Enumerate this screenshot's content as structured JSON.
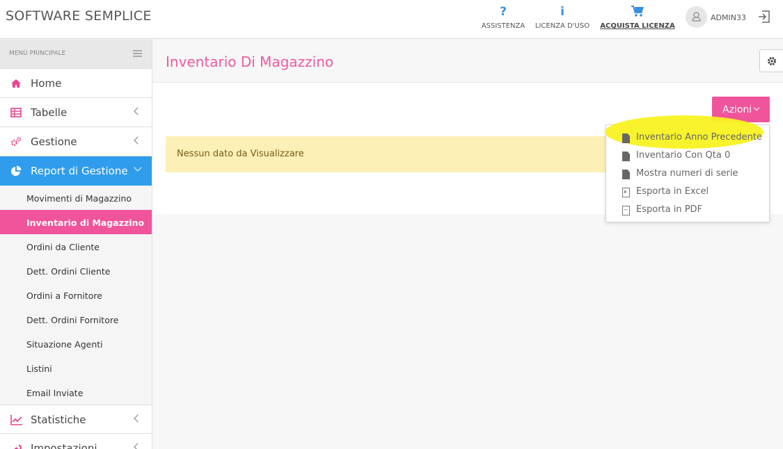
{
  "brand": "SOFTWARE SEMPLICE",
  "topnav": [
    {
      "icon": "question-icon",
      "glyph": "?",
      "label": "ASSISTENZA"
    },
    {
      "icon": "info-icon",
      "glyph": "i",
      "label": "LICENZA D'USO"
    },
    {
      "icon": "cart-icon",
      "glyph": "🛒",
      "label": "ACQUISTA LICENZA"
    }
  ],
  "user": {
    "name": "ADMIN33"
  },
  "sidebar": {
    "header": "MENÙ PRINCIPALE",
    "items": [
      {
        "label": "Home"
      },
      {
        "label": "Tabelle"
      },
      {
        "label": "Gestione"
      },
      {
        "label": "Report di Gestione"
      }
    ],
    "sub": [
      {
        "label": "Movimenti di Magazzino"
      },
      {
        "label": "Inventario di Magazzino"
      },
      {
        "label": "Ordini da Cliente"
      },
      {
        "label": "Dett. Ordini Cliente"
      },
      {
        "label": "Ordini a Fornitore"
      },
      {
        "label": "Dett. Ordini Fornitore"
      },
      {
        "label": "Situazione Agenti"
      },
      {
        "label": "Listini"
      },
      {
        "label": "Email Inviate"
      }
    ],
    "after": [
      {
        "label": "Statistiche"
      },
      {
        "label": "Impostazioni"
      }
    ]
  },
  "page": {
    "title": "Inventario Di Magazzino",
    "actions_label": "Azioni",
    "alert": "Nessun dato da Visualizzare"
  },
  "dropdown": [
    {
      "label": "Inventario Anno Precedente",
      "icon": "file-icon"
    },
    {
      "label": "Inventario Con Qta 0",
      "icon": "file-icon"
    },
    {
      "label": "Mostra numeri di serie",
      "icon": "file-icon"
    },
    {
      "label": "Esporta in Excel",
      "icon": "excel-file-icon"
    },
    {
      "label": "Esporta in PDF",
      "icon": "pdf-file-icon"
    }
  ],
  "colors": {
    "accent": "#f0549a",
    "active": "#2f9dec",
    "highlight": "#f8f222"
  }
}
